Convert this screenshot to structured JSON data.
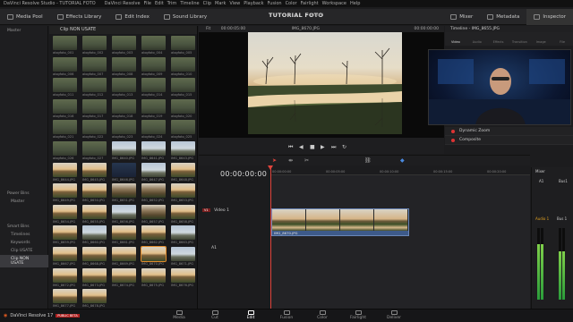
{
  "app": {
    "title": "DaVinci Resolve Studio - TUTORIAL FOTO",
    "menu": [
      "DaVinci Resolve",
      "File",
      "Edit",
      "Trim",
      "Timeline",
      "Clip",
      "Mark",
      "View",
      "Playback",
      "Fusion",
      "Color",
      "Fairlight",
      "Workspace",
      "Help"
    ]
  },
  "toolbar": {
    "media_pool": "Media Pool",
    "effects_library": "Effects Library",
    "edit_index": "Edit Index",
    "sound_library": "Sound Library",
    "project_title": "TUTORIAL FOTO",
    "edited": "Edited",
    "mixer": "Mixer",
    "metadata": "Metadata",
    "inspector": "Inspector"
  },
  "sidebar": {
    "master_header": "Master",
    "power_bins": "Power Bins",
    "power_master": "Master",
    "smart_bins": "Smart Bins",
    "smart_items": [
      "Timelines",
      "Keywords",
      "Clip USATE",
      "Clip NON USATE"
    ]
  },
  "pool": {
    "header": "Clip NON USATE",
    "items": [
      {
        "name": "alogfoto_001",
        "tone": "dark"
      },
      {
        "name": "alogfoto_002",
        "tone": "dark"
      },
      {
        "name": "alogfoto_003",
        "tone": "dark"
      },
      {
        "name": "alogfoto_004",
        "tone": "dark"
      },
      {
        "name": "alogfoto_005",
        "tone": "dark"
      },
      {
        "name": "alogfoto_006",
        "tone": "dark"
      },
      {
        "name": "alogfoto_007",
        "tone": "dark"
      },
      {
        "name": "alogfoto_008",
        "tone": "dark"
      },
      {
        "name": "alogfoto_009",
        "tone": "dark"
      },
      {
        "name": "alogfoto_010",
        "tone": "dark"
      },
      {
        "name": "alogfoto_011",
        "tone": "dark"
      },
      {
        "name": "alogfoto_012",
        "tone": "dark"
      },
      {
        "name": "alogfoto_013",
        "tone": "dark"
      },
      {
        "name": "alogfoto_014",
        "tone": "dark"
      },
      {
        "name": "alogfoto_015",
        "tone": "dark"
      },
      {
        "name": "alogfoto_016",
        "tone": "dark"
      },
      {
        "name": "alogfoto_017",
        "tone": "dark"
      },
      {
        "name": "alogfoto_018",
        "tone": "dark"
      },
      {
        "name": "alogfoto_019",
        "tone": "dark"
      },
      {
        "name": "alogfoto_020",
        "tone": "dark"
      },
      {
        "name": "alogfoto_021",
        "tone": "dark"
      },
      {
        "name": "alogfoto_022",
        "tone": "dark"
      },
      {
        "name": "alogfoto_023",
        "tone": "dark"
      },
      {
        "name": "alogfoto_024",
        "tone": "dark"
      },
      {
        "name": "alogfoto_025",
        "tone": "dark"
      },
      {
        "name": "alogfoto_026",
        "tone": "dark"
      },
      {
        "name": "alogfoto_027",
        "tone": "dark"
      },
      {
        "name": "IMG_8640.JPG",
        "tone": "sky"
      },
      {
        "name": "IMG_8641.JPG",
        "tone": "sky"
      },
      {
        "name": "IMG_8643.JPG",
        "tone": "sky"
      },
      {
        "name": "IMG_8644.JPG",
        "tone": "sunset"
      },
      {
        "name": "IMG_8645.JPG",
        "tone": "sunset"
      },
      {
        "name": "IMG_8646.JPG",
        "tone": "night"
      },
      {
        "name": "IMG_8647.JPG",
        "tone": "sky"
      },
      {
        "name": "IMG_8648.JPG",
        "tone": "sunset"
      },
      {
        "name": "IMG_8649.JPG",
        "tone": "sunset"
      },
      {
        "name": "IMG_8650.JPG",
        "tone": "sunset"
      },
      {
        "name": "IMG_8651.JPG",
        "tone": "trees"
      },
      {
        "name": "IMG_8652.JPG",
        "tone": "trees"
      },
      {
        "name": "IMG_8653.JPG",
        "tone": "sunset"
      },
      {
        "name": "IMG_8654.JPG",
        "tone": "sunset"
      },
      {
        "name": "IMG_8655.JPG",
        "tone": "sunset"
      },
      {
        "name": "IMG_8656.JPG",
        "tone": "sky"
      },
      {
        "name": "IMG_8657.JPG",
        "tone": "trees"
      },
      {
        "name": "IMG_8658.JPG",
        "tone": "sunset"
      },
      {
        "name": "IMG_8659.JPG",
        "tone": "sunset"
      },
      {
        "name": "IMG_8660.JPG",
        "tone": "sky"
      },
      {
        "name": "IMG_8661.JPG",
        "tone": "sunset"
      },
      {
        "name": "IMG_8662.JPG",
        "tone": "sunset"
      },
      {
        "name": "IMG_8663.JPG",
        "tone": "sky"
      },
      {
        "name": "IMG_8667.JPG",
        "tone": "sunset"
      },
      {
        "name": "IMG_8668.JPG",
        "tone": "sunset"
      },
      {
        "name": "IMG_8669.JPG",
        "tone": "sunset"
      },
      {
        "name": "IMG_8670.JPG",
        "tone": "sunset",
        "selected": true
      },
      {
        "name": "IMG_8671.JPG",
        "tone": "sky"
      },
      {
        "name": "IMG_8672.JPG",
        "tone": "sunset"
      },
      {
        "name": "IMG_8673.JPG",
        "tone": "sunset"
      },
      {
        "name": "IMG_8674.JPG",
        "tone": "sunset"
      },
      {
        "name": "IMG_8675.JPG",
        "tone": "sunset"
      },
      {
        "name": "IMG_8676.JPG",
        "tone": "sunset"
      },
      {
        "name": "IMG_8677.JPG",
        "tone": "sunset"
      },
      {
        "name": "IMG_8678.JPG",
        "tone": "sunset"
      }
    ]
  },
  "viewer": {
    "fit": "Fit",
    "timecode": "00:00:05:00",
    "clip_name": "IMG_8670.JPG",
    "source_tc": "00:00:00:00"
  },
  "inspector": {
    "header": "Timeline - IMG_8655.JPG",
    "tabs": [
      "Video",
      "Audio",
      "Effects",
      "Transition",
      "Image",
      "File"
    ],
    "items": [
      "Dynamic Zoom",
      "Composite"
    ]
  },
  "timeline": {
    "timecode": "00:00:00:00",
    "ruler_marks": [
      "00:00:00:00",
      "00:00:05:00",
      "00:00:10:00",
      "00:00:15:00",
      "00:00:20:00"
    ],
    "video_track": "Video 1",
    "video_badge": "V1",
    "audio_track": "A1",
    "clip_name": "IMG_8670.JPG",
    "clip_frames": 4
  },
  "mixer": {
    "title": "Mixer",
    "a1": "A1",
    "bus1": "Bus1",
    "audio1": "Audio 1",
    "bus1b": "Bus 1",
    "level_a1": 0.78,
    "level_bus1": 0.67
  },
  "bottom": {
    "product": "DaVinci Resolve 17",
    "beta": "PUBLIC BETA",
    "pages": [
      "Media",
      "Cut",
      "Edit",
      "Fusion",
      "Color",
      "Fairlight",
      "Deliver"
    ],
    "active_page": "Edit"
  }
}
